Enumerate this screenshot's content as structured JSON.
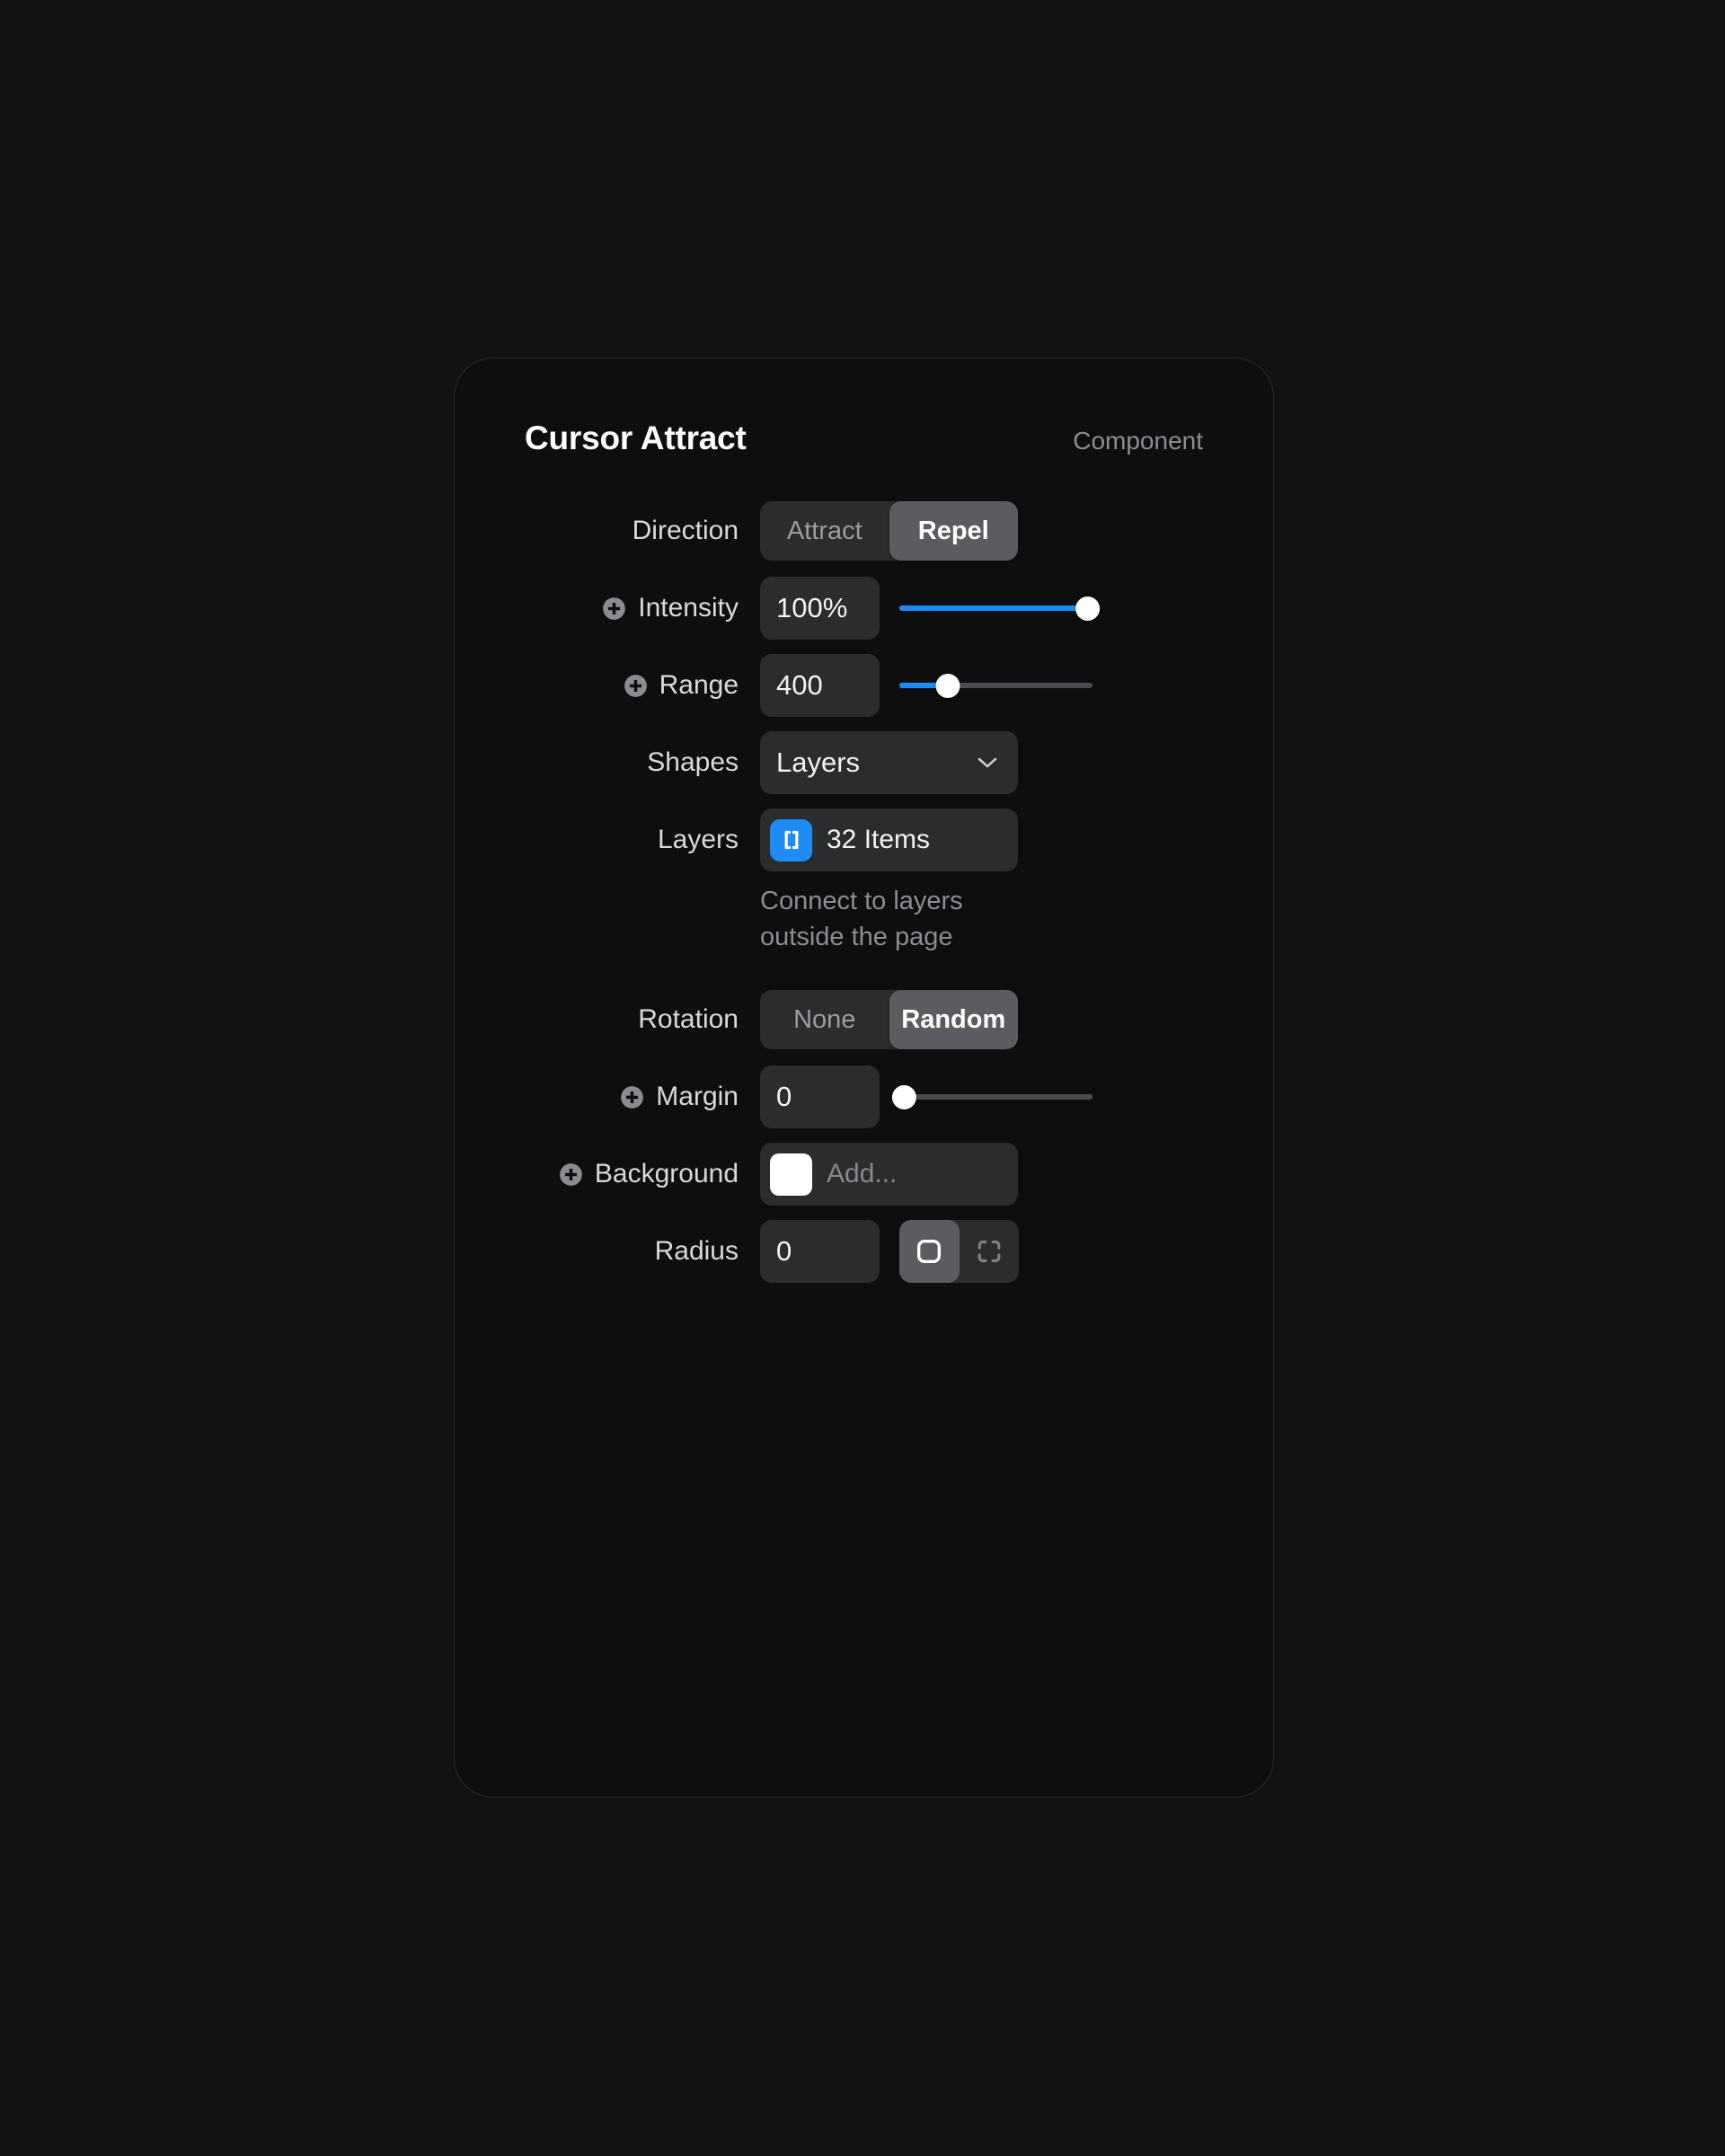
{
  "panel": {
    "title": "Cursor Attract",
    "kind": "Component",
    "accent_color": "#1f8bf5",
    "background_color": "#0d0e10",
    "page_background_color": "#111214"
  },
  "rows": {
    "direction": {
      "label": "Direction",
      "options": [
        "Attract",
        "Repel"
      ],
      "selected": "Repel"
    },
    "intensity": {
      "label": "Intensity",
      "icon": "plus-circle-icon",
      "value": "100%",
      "slider_percent": 100
    },
    "range": {
      "label": "Range",
      "icon": "plus-circle-icon",
      "value": "400",
      "slider_percent": 25
    },
    "shapes": {
      "label": "Shapes",
      "value": "Layers",
      "icon": "chevron-down-icon"
    },
    "layers": {
      "label": "Layers",
      "value": "32 Items",
      "badge_icon": "brackets-icon",
      "badge_color": "#1f8bf5",
      "help": "Connect to layers outside the page"
    },
    "rotation": {
      "label": "Rotation",
      "options": [
        "None",
        "Random"
      ],
      "selected": "Random"
    },
    "margin": {
      "label": "Margin",
      "icon": "plus-circle-icon",
      "value": "0",
      "slider_percent": 0
    },
    "background": {
      "label": "Background",
      "icon": "plus-circle-icon",
      "placeholder": "Add...",
      "swatch_color": "#ffffff"
    },
    "radius": {
      "label": "Radius",
      "value": "0",
      "modes": [
        "uniform",
        "individual"
      ],
      "selected": "uniform",
      "uniform_icon": "rounded-square-icon",
      "individual_icon": "corners-icon"
    }
  }
}
